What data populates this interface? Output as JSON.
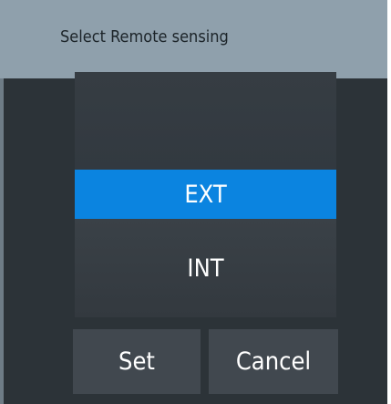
{
  "dialog": {
    "title": "Select Remote sensing"
  },
  "picker": {
    "options": [
      {
        "label": "EXT",
        "selected": true
      },
      {
        "label": "INT",
        "selected": false
      }
    ],
    "selected_value": "EXT"
  },
  "buttons": {
    "set_label": "Set",
    "cancel_label": "Cancel"
  },
  "colors": {
    "title_bar": "#8fa0ac",
    "dialog_background": "#2c3338",
    "selection_highlight": "#0b84e0",
    "button_background": "#41484f"
  }
}
